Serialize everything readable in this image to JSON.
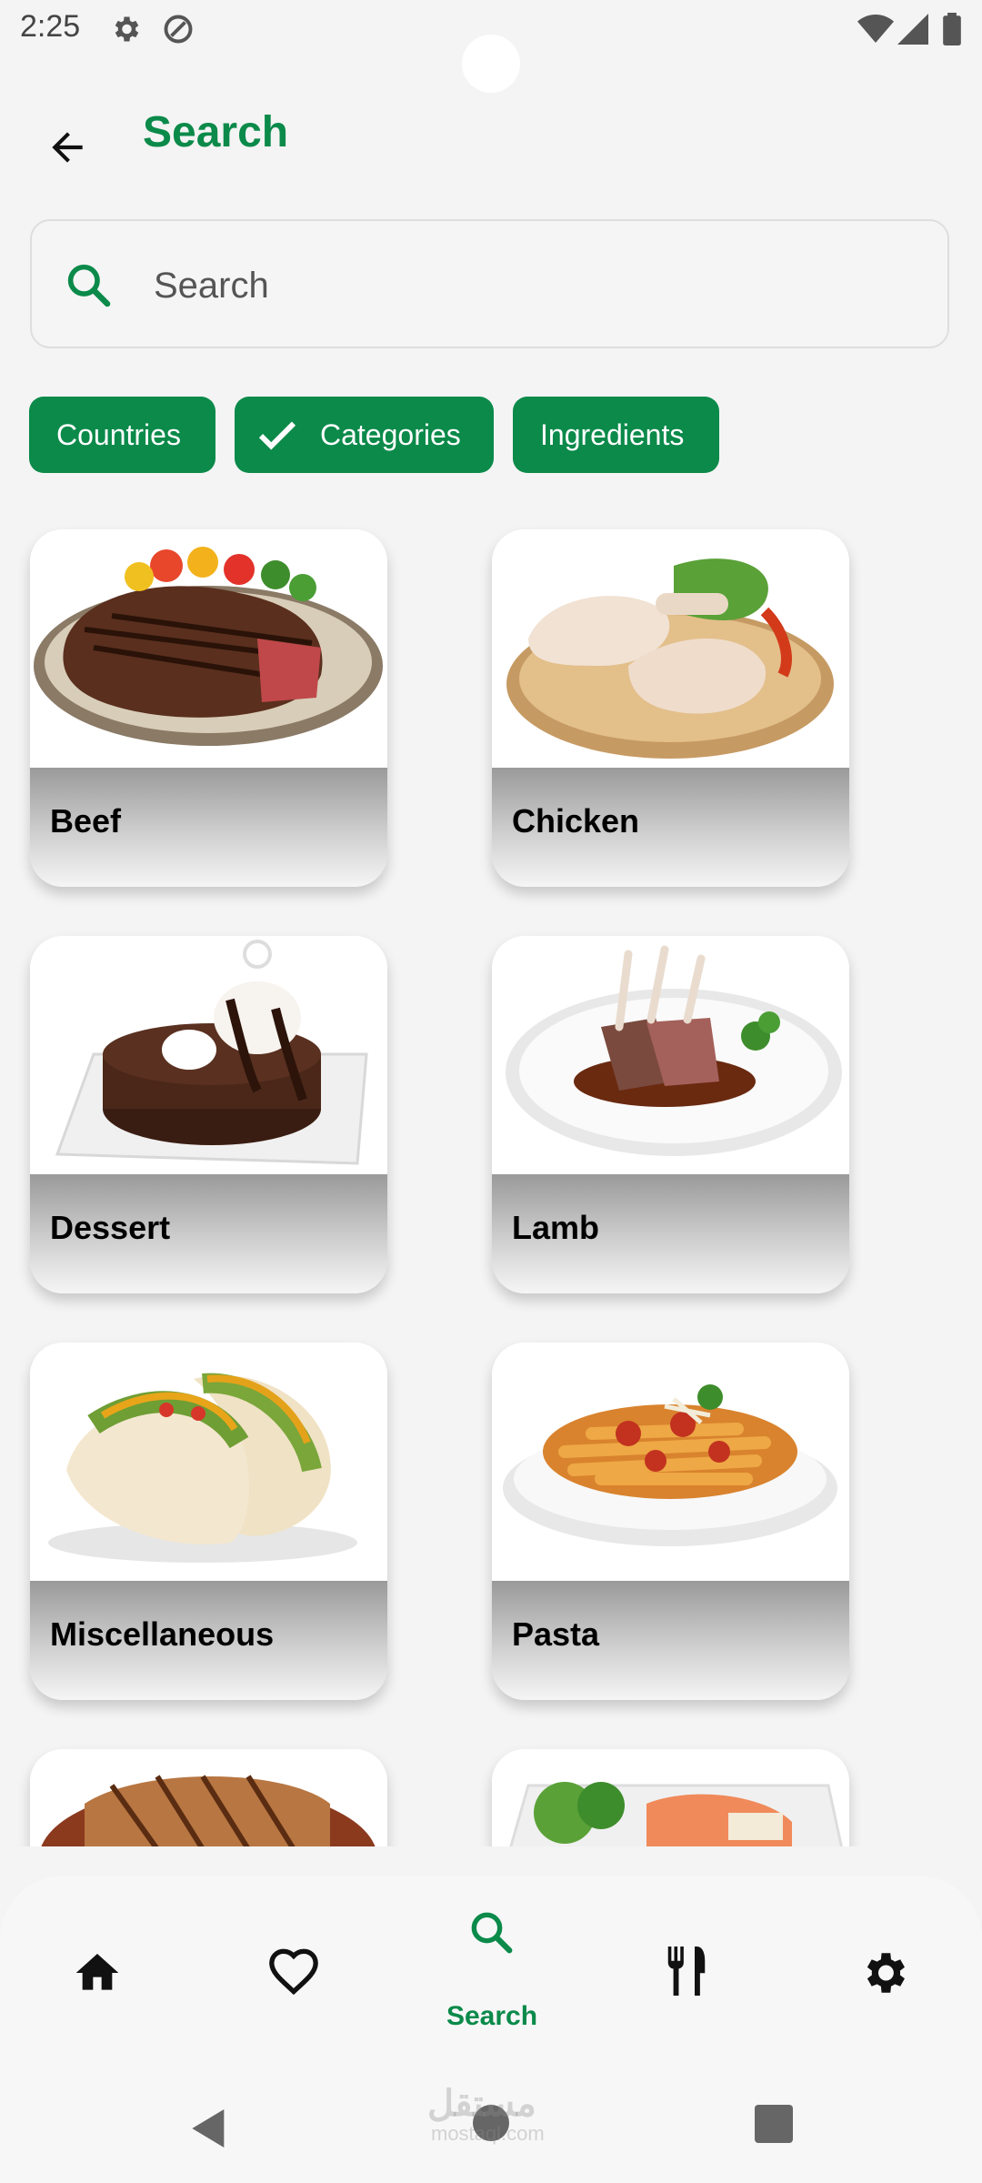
{
  "status_bar": {
    "time": "2:25"
  },
  "header": {
    "title": "Search"
  },
  "search": {
    "placeholder": "Search"
  },
  "filters": [
    {
      "label": "Countries",
      "selected": false
    },
    {
      "label": "Categories",
      "selected": true
    },
    {
      "label": "Ingredients",
      "selected": false
    }
  ],
  "categories": [
    {
      "name": "Beef"
    },
    {
      "name": "Chicken"
    },
    {
      "name": "Dessert"
    },
    {
      "name": "Lamb"
    },
    {
      "name": "Miscellaneous"
    },
    {
      "name": "Pasta"
    }
  ],
  "bottom_nav": {
    "active": "search",
    "items": [
      {
        "id": "home",
        "icon": "home-icon"
      },
      {
        "id": "favorites",
        "icon": "heart-icon"
      },
      {
        "id": "search",
        "icon": "search-icon",
        "label": "Search"
      },
      {
        "id": "meals",
        "icon": "fork-knife-icon"
      },
      {
        "id": "settings",
        "icon": "gear-icon"
      }
    ]
  },
  "watermark": {
    "text": "مستقل",
    "sub": "mostaql.com"
  },
  "colors": {
    "accent": "#0b8a4a",
    "background": "#f4f4f4"
  }
}
